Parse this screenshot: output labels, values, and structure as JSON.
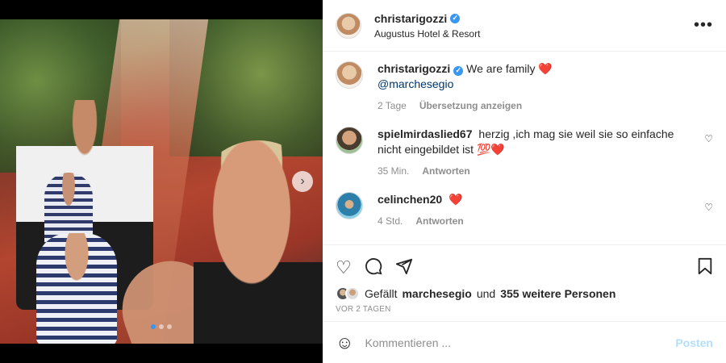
{
  "post": {
    "username": "christarigozzi",
    "location": "Augustus Hotel & Resort",
    "more_icon": "more-horizontal-icon"
  },
  "caption": {
    "username": "christarigozzi",
    "text": "We are family",
    "emoji": "❤️",
    "mention": "@marchesegio",
    "time": "2 Tage",
    "translate": "Übersetzung anzeigen"
  },
  "comments": [
    {
      "username": "spielmirdaslied67",
      "text": "herzig ,ich mag sie weil sie so einfache nicht eingebildet ist",
      "emoji": "💯❤️",
      "time": "35 Min.",
      "reply": "Antworten"
    },
    {
      "username": "celinchen20",
      "text": "",
      "emoji": "❤️",
      "time": "4 Std.",
      "reply": "Antworten"
    }
  ],
  "likes": {
    "prefix": "Gefällt",
    "user": "marchesegio",
    "middle": "und",
    "others": "355 weitere Personen"
  },
  "timestamp": "VOR 2 TAGEN",
  "add_comment": {
    "placeholder": "Kommentieren ...",
    "post_label": "Posten"
  },
  "carousel": {
    "next_symbol": "›",
    "count": 3,
    "active_index": 0
  },
  "colors": {
    "verified": "#3897f0",
    "heart": "#ed4956",
    "post_disabled": "#b2dffc"
  }
}
